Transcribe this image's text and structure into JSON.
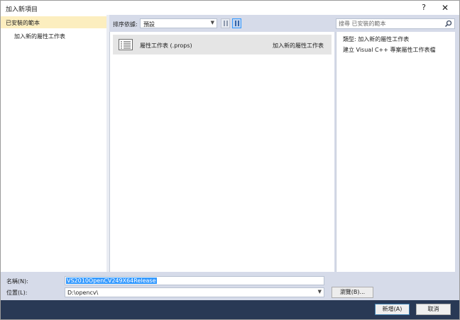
{
  "window": {
    "title": "加入新項目",
    "help_label": "?",
    "close_label": "✕"
  },
  "sidebar": {
    "root_label": "已安裝的範本",
    "items": [
      {
        "label": "加入新的屬性工作表"
      }
    ]
  },
  "toolbar": {
    "sort_label": "排序依據:",
    "sort_value": "預設",
    "search_placeholder": "搜尋 已安裝的範本"
  },
  "templates": [
    {
      "name": "屬性工作表 (.props)",
      "category": "加入新的屬性工作表",
      "icon": "property-sheet-icon"
    }
  ],
  "details": {
    "type_line": "類型: 加入新的屬性工作表",
    "description": "建立 Visual C++ 專案屬性工作表檔"
  },
  "form": {
    "name_label": "名稱(N):",
    "name_value": "VS2010OpenCV249X64Release",
    "location_label": "位置(L):",
    "location_value": "D:\\opencv\\",
    "browse_label": "瀏覽(B)..."
  },
  "footer": {
    "ok_label": "新增(A)",
    "cancel_label": "取消"
  },
  "colors": {
    "selected_root": "#fceebf",
    "footer_bg": "#293955",
    "dialog_bg": "#d6dbe9",
    "selection": "#3399ff"
  }
}
